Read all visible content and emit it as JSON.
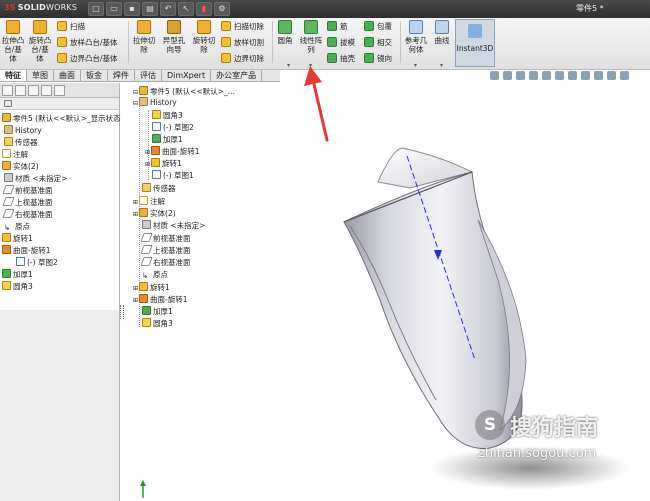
{
  "app": {
    "logo_ds": "3S",
    "logo_solid": "SOLID",
    "logo_works": "WORKS",
    "document_title": "零件5 *"
  },
  "quick_access": [
    "new-icon",
    "open-icon",
    "save-icon",
    "print-icon",
    "undo-icon",
    "select-icon",
    "rebuild-icon",
    "options-icon"
  ],
  "ribbon": {
    "extrude_boss": "拉伸凸\n台/基\n体",
    "revolve_boss": "旋转凸\n台/基\n体",
    "sweep_boss": "扫描",
    "loft_boss": "放样凸台/基体",
    "boundary_boss": "边界凸台/基体",
    "extrude_cut": "拉伸切\n除",
    "hole_wizard": "异型孔\n向导",
    "revolve_cut": "旋转切\n除",
    "sweep_cut": "扫描切除",
    "loft_cut": "放样切割",
    "boundary_cut": "边界切除",
    "fillet": "圆角",
    "linear_pattern": "线性阵\n列",
    "rib": "筋",
    "draft": "拔模",
    "shell": "抽壳",
    "wrap": "包覆",
    "intersect": "相交",
    "mirror": "镜向",
    "ref_geometry": "参考几\n何体",
    "curves": "曲线",
    "instant3d": "Instant3D"
  },
  "tabs": [
    "特征",
    "草图",
    "曲面",
    "钣金",
    "焊件",
    "评估",
    "DimXpert",
    "办公室产品"
  ],
  "left_tree": [
    "零件5 (默认<<默认>_显示状态",
    "History",
    "传感器",
    "注解",
    "实体(2)",
    "材质 <未指定>",
    "前视基准面",
    "上视基准面",
    "右视基准面",
    "原点",
    "旋转1",
    "曲面-旋转1",
    "(-) 草图2",
    "加厚1",
    "圆角3"
  ],
  "flyout_tree": {
    "root": "零件5 (默认<<默认>_...",
    "history": "History",
    "history_items": [
      "圆角3",
      "(-) 草图2",
      "加厚1",
      "曲面-旋转1",
      "旋转1",
      "(-) 草图1"
    ],
    "items": [
      "传感器",
      "注解",
      "实体(2)",
      "材质 <未指定>",
      "前视基准面",
      "上视基准面",
      "右视基准面",
      "原点",
      "旋转1",
      "曲面-旋转1",
      "加厚1",
      "圆角3"
    ]
  },
  "watermark": {
    "logo_char": "S",
    "text": "搜狗指南",
    "url": "zhinan.sogou.com"
  },
  "colors": {
    "annotation_arrow": "#e53935",
    "axis_line": "#2233cc",
    "model_body": "#e6e6ec",
    "title_bar": "#3a3a3a"
  }
}
